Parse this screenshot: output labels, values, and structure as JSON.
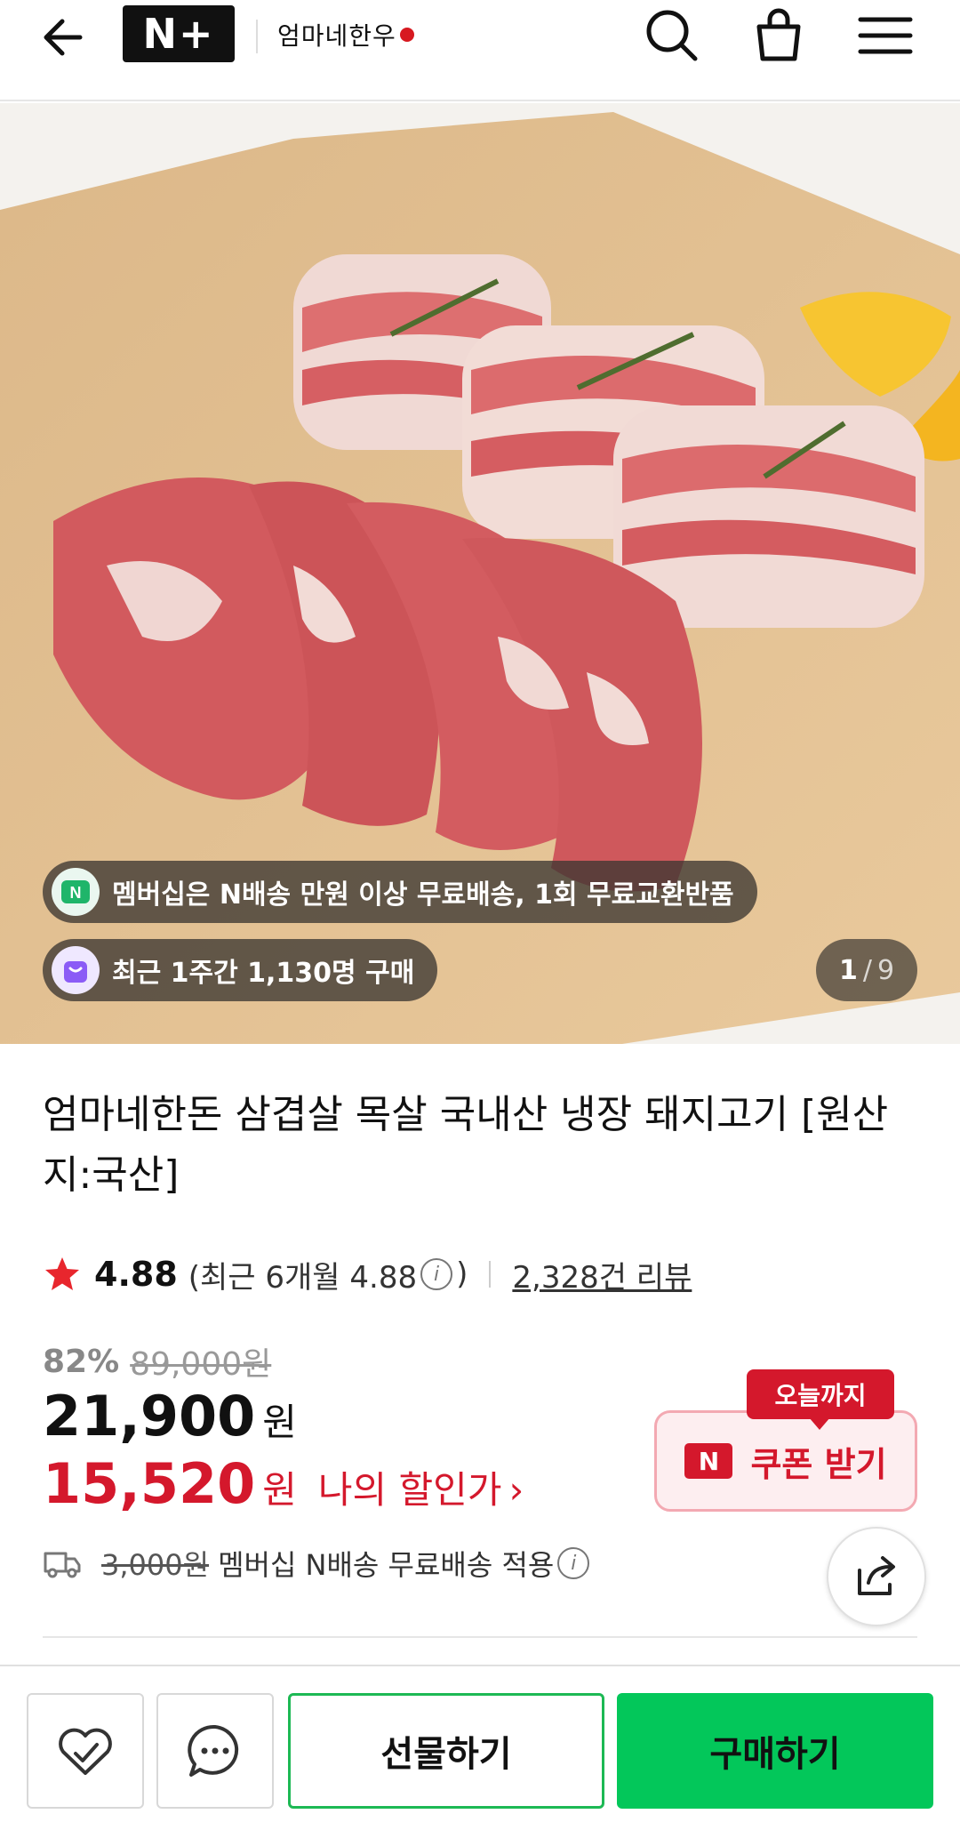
{
  "header": {
    "brand_badge": "N+",
    "store_name": "엄마네한우"
  },
  "hero": {
    "membership_text": "멤버십은 N배송 만원 이상 무료배송, 1회 무료교환반품",
    "recent_purchase_text": "최근 1주간 1,130명 구매",
    "page_current": "1",
    "page_separator": "/",
    "page_total": "9"
  },
  "product": {
    "title": "엄마네한돈 삼겹살 목살 국내산 냉장 돼지고기 [원산지:국산]",
    "rating_score": "4.88",
    "rating_recent_prefix": "(최근 6개월 4.88",
    "rating_recent_suffix": ")",
    "info_glyph": "i",
    "review_count": "2,328건 리뷰",
    "discount_percent": "82%",
    "original_price": "89,000원",
    "price": "21,900",
    "price_unit": "원",
    "my_price": "15,520",
    "my_price_unit": "원",
    "my_price_label": "나의 할인가",
    "my_price_chevron": "›",
    "shipping_fee": "3,000원",
    "shipping_text": "멤버십 N배송 무료배송 적용"
  },
  "coupon": {
    "tag": "오늘까지",
    "logo": "N",
    "label": "쿠폰 받기"
  },
  "bottom_bar": {
    "gift_label": "선물하기",
    "buy_label": "구매하기"
  },
  "colors": {
    "accent_red": "#d4182c",
    "naver_green": "#03c75a"
  }
}
